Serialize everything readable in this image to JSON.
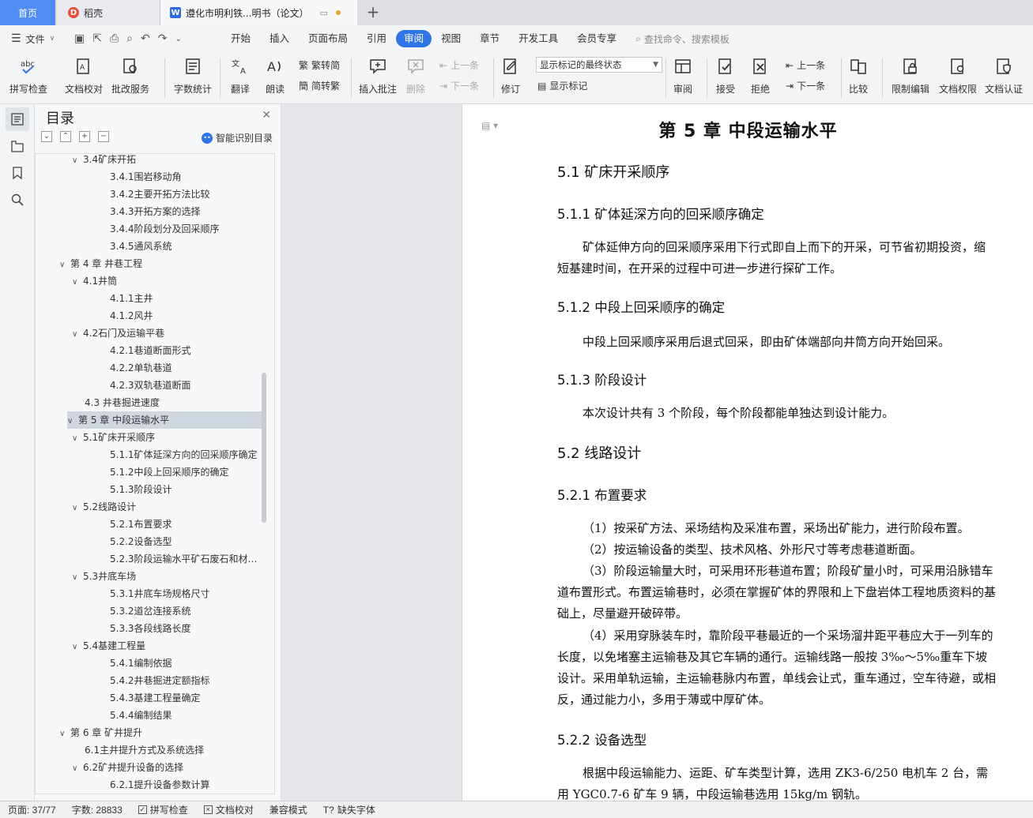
{
  "tabs": {
    "home": "首页",
    "shell": "稻壳",
    "doc_title": "遵化市明利铁...明书（论文）"
  },
  "menu": {
    "file": "文件",
    "items": [
      "开始",
      "插入",
      "页面布局",
      "引用",
      "审阅",
      "视图",
      "章节",
      "开发工具",
      "会员专享"
    ],
    "active": "审阅",
    "search": "查找命令、搜索模板"
  },
  "ribbon": {
    "spell": "拼写检查",
    "proofread": "文档校对",
    "annotate_service": "批改服务",
    "word_count": "字数统计",
    "translate": "翻译",
    "read_aloud": "朗读",
    "to_traditional": "繁转简",
    "to_simplified": "简转繁",
    "insert_comment": "插入批注",
    "delete": "删除",
    "prev_comment": "上一条",
    "next_comment": "下一条",
    "track": "修订",
    "markup_state": "显示标记的最终状态",
    "show_markup": "显示标记",
    "review": "审阅",
    "accept": "接受",
    "reject": "拒绝",
    "prev_change": "上一条",
    "next_change": "下一条",
    "compare": "比较",
    "restrict": "限制编辑",
    "permission": "文档权限",
    "certify": "文档认证"
  },
  "toc": {
    "title": "目录",
    "smart": "智能识别目录",
    "items": [
      {
        "text": "3.4矿床开拓",
        "level": 2,
        "chev": true
      },
      {
        "text": "3.4.1围岩移动角",
        "level": 3
      },
      {
        "text": "3.4.2主要开拓方法比较",
        "level": 3
      },
      {
        "text": "3.4.3开拓方案的选择",
        "level": 3
      },
      {
        "text": "3.4.4阶段划分及回采顺序",
        "level": 3
      },
      {
        "text": "3.4.5通风系统",
        "level": 3
      },
      {
        "text": "第 4 章  井巷工程",
        "level": 1,
        "chev": true
      },
      {
        "text": "4.1井筒",
        "level": 2,
        "chev": true
      },
      {
        "text": "4.1.1主井",
        "level": 3
      },
      {
        "text": "4.1.2风井",
        "level": 3
      },
      {
        "text": "4.2石门及运输平巷",
        "level": 2,
        "chev": true
      },
      {
        "text": "4.2.1巷道断面形式",
        "level": 3
      },
      {
        "text": "4.2.2单轨巷道",
        "level": 3
      },
      {
        "text": "4.2.3双轨巷道断面",
        "level": 3
      },
      {
        "text": "4.3 井巷掘进速度",
        "level": 2
      },
      {
        "text": "第 5 章  中段运输水平",
        "level": 1,
        "chev": true,
        "selected": true
      },
      {
        "text": "5.1矿床开采顺序",
        "level": 2,
        "chev": true
      },
      {
        "text": "5.1.1矿体延深方向的回采顺序确定",
        "level": 3
      },
      {
        "text": "5.1.2中段上回采顺序的确定",
        "level": 3
      },
      {
        "text": "5.1.3阶段设计",
        "level": 3
      },
      {
        "text": "5.2线路设计",
        "level": 2,
        "chev": true
      },
      {
        "text": "5.2.1布置要求",
        "level": 3
      },
      {
        "text": "5.2.2设备选型",
        "level": 3
      },
      {
        "text": "5.2.3阶段运输水平矿石废石和材料运输",
        "level": 3
      },
      {
        "text": "5.3井底车场",
        "level": 2,
        "chev": true
      },
      {
        "text": "5.3.1井底车场规格尺寸",
        "level": 3
      },
      {
        "text": "5.3.2道岔连接系统",
        "level": 3
      },
      {
        "text": "5.3.3各段线路长度",
        "level": 3
      },
      {
        "text": "5.4基建工程量",
        "level": 2,
        "chev": true
      },
      {
        "text": "5.4.1编制依据",
        "level": 3
      },
      {
        "text": "5.4.2井巷掘进定额指标",
        "level": 3
      },
      {
        "text": "5.4.3基建工程量确定",
        "level": 3
      },
      {
        "text": "5.4.4编制结果",
        "level": 3
      },
      {
        "text": "第 6 章  矿井提升",
        "level": 1,
        "chev": true
      },
      {
        "text": "6.1主井提升方式及系统选择",
        "level": 2
      },
      {
        "text": "6.2矿井提升设备的选择",
        "level": 2,
        "chev": true
      },
      {
        "text": "6.2.1提升设备参数计算",
        "level": 3
      }
    ]
  },
  "doc": {
    "chapter": "第  5 章   中段运输水平",
    "s51": "5.1   矿床开采顺序",
    "s511": "5.1.1   矿体延深方向的回采顺序确定",
    "p511": "矿体延伸方向的回采顺序采用下行式即自上而下的开采，可节省初期投资，缩短基建时间，在开采的过程中可进一步进行探矿工作。",
    "s512": "5.1.2   中段上回采顺序的确定",
    "p512": "中段上回采顺序采用后退式回采，即由矿体端部向井筒方向开始回采。",
    "s513": "5.1.3   阶段设计",
    "p513": "本次设计共有  3 个阶段，每个阶段都能单独达到设计能力。",
    "s52": "5.2   线路设计",
    "s521": "5.2.1   布置要求",
    "p521a": "（1）按采矿方法、采场结构及采准布置，采场出矿能力，进行阶段布置。",
    "p521b": "（2）按运输设备的类型、技术风格、外形尺寸等考虑巷道断面。",
    "p521c": "（3）阶段运输量大时，可采用环形巷道布置；阶段矿量小时，可采用沿脉错车道布置形式。布置运输巷时，必须在掌握矿体的界限和上下盘岩体工程地质资料的基础上，尽量避开破碎带。",
    "p521d": "（4）采用穿脉装车时，靠阶段平巷最近的一个采场溜井距平巷应大于一列车的长度，以免堵塞主运输巷及其它车辆的通行。运输线路一般按  3‰～5‰重车下坡设计。采用单轨运输，主运输巷脉内布置，单线会让式，重车通过，空车待避，或相反，通过能力小，多用于薄或中厚矿体。",
    "s522": "5.2.2   设备选型",
    "p522": "根据中段运输能力、运距、矿车类型计算，选用  ZK3-6/250 电机车  2 台，需用 YGC0.7-6 矿车 9 辆，中段运输巷选用 15kg/m 钢轨。"
  },
  "status": {
    "page": "页面: 37/77",
    "words": "字数: 28833",
    "spell": "拼写检查",
    "proof": "文档校对",
    "compat": "兼容模式",
    "missing_font": "缺失字体"
  }
}
